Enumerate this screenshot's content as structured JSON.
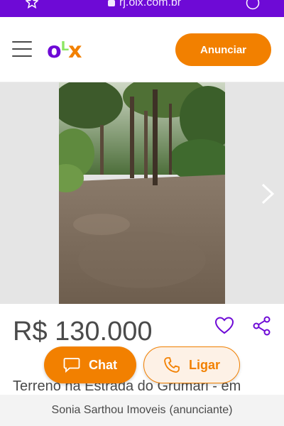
{
  "browser": {
    "url": "rj.olx.com.br",
    "icons": [
      "star-icon",
      "lock-icon",
      "menu-circle-icon"
    ]
  },
  "header": {
    "logo": {
      "o": "o",
      "l": "L",
      "x": "x"
    },
    "menu_icon": "hamburger-icon",
    "cta_label": "Anunciar"
  },
  "gallery": {
    "photo_subject": "land-with-trees",
    "next_icon": "chevron-right-icon"
  },
  "listing": {
    "price": "R$ 130.000",
    "title": "Terreno na Estrada do Grumari - em",
    "favorite_icon": "heart-icon",
    "share_icon": "share-icon"
  },
  "actions": {
    "chat_label": "Chat",
    "call_label": "Ligar"
  },
  "seller": {
    "name": "Sonia Sarthou Imoveis",
    "role": "(anunciante)"
  },
  "colors": {
    "brand_purple": "#6e0ad6",
    "brand_orange": "#f28000",
    "brand_green": "#8ce563"
  }
}
